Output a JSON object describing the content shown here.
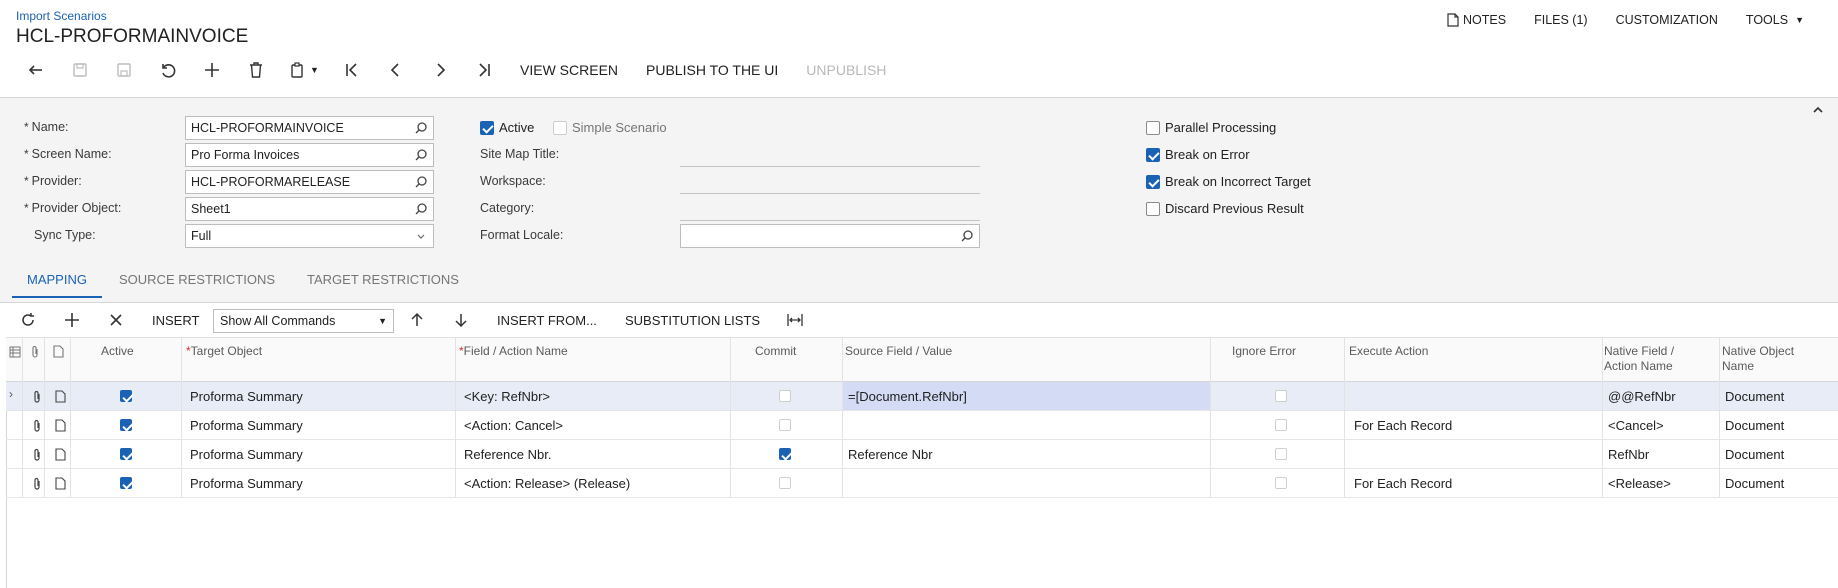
{
  "breadcrumb": "Import Scenarios",
  "page_title": "HCL-PROFORMAINVOICE",
  "top_links": {
    "notes": "NOTES",
    "files": "FILES (1)",
    "customization": "CUSTOMIZATION",
    "tools": "TOOLS"
  },
  "toolbar": {
    "view_screen": "VIEW SCREEN",
    "publish": "PUBLISH TO THE UI",
    "unpublish": "UNPUBLISH"
  },
  "form": {
    "name_label": "Name:",
    "name_value": "HCL-PROFORMAINVOICE",
    "screen_name_label": "Screen Name:",
    "screen_name_value": "Pro Forma Invoices",
    "provider_label": "Provider:",
    "provider_value": "HCL-PROFORMARELEASE",
    "provider_object_label": "Provider Object:",
    "provider_object_value": "Sheet1",
    "sync_type_label": "Sync Type:",
    "sync_type_value": "Full",
    "active_label": "Active",
    "simple_scenario_label": "Simple Scenario",
    "site_map_title_label": "Site Map Title:",
    "workspace_label": "Workspace:",
    "category_label": "Category:",
    "format_locale_label": "Format Locale:",
    "format_locale_value": "",
    "parallel_processing_label": "Parallel Processing",
    "break_on_error_label": "Break on Error",
    "break_on_incorrect_target_label": "Break on Incorrect Target",
    "discard_previous_result_label": "Discard Previous Result",
    "active_checked": true,
    "simple_scenario_checked": false,
    "parallel_processing_checked": false,
    "break_on_error_checked": true,
    "break_on_incorrect_target_checked": true,
    "discard_previous_result_checked": false
  },
  "tabs": [
    "MAPPING",
    "SOURCE RESTRICTIONS",
    "TARGET RESTRICTIONS"
  ],
  "grid_toolbar": {
    "insert": "INSERT",
    "commands_select": "Show All Commands",
    "insert_from": "INSERT FROM...",
    "substitution_lists": "SUBSTITUTION LISTS"
  },
  "columns": {
    "active": "Active",
    "target_object": "Target Object",
    "field_action_name": "Field / Action Name",
    "commit": "Commit",
    "source_field_value": "Source Field / Value",
    "ignore_error": "Ignore Error",
    "execute_action": "Execute Action",
    "native_field_line1": "Native Field /",
    "native_field_line2": "Action Name",
    "native_object_line1": "Native Object",
    "native_object_line2": "Name"
  },
  "rows": [
    {
      "active": true,
      "target_object": "Proforma Summary",
      "field_action_name": "<Key: RefNbr>",
      "commit": false,
      "source_field_value": "=[Document.RefNbr]",
      "ignore_error": false,
      "execute_action": "",
      "native_field": "@@RefNbr",
      "native_object": "Document"
    },
    {
      "active": true,
      "target_object": "Proforma Summary",
      "field_action_name": "<Action: Cancel>",
      "commit": false,
      "source_field_value": "",
      "ignore_error": false,
      "execute_action": "For Each Record",
      "native_field": "<Cancel>",
      "native_object": "Document"
    },
    {
      "active": true,
      "target_object": "Proforma Summary",
      "field_action_name": "Reference Nbr.",
      "commit": true,
      "source_field_value": "Reference Nbr",
      "ignore_error": false,
      "execute_action": "",
      "native_field": "RefNbr",
      "native_object": "Document"
    },
    {
      "active": true,
      "target_object": "Proforma Summary",
      "field_action_name": "<Action: Release> (Release)",
      "commit": false,
      "source_field_value": "",
      "ignore_error": false,
      "execute_action": "For Each Record",
      "native_field": "<Release>",
      "native_object": "Document"
    }
  ],
  "colors": {
    "accent": "#1a62b4",
    "selected_row": "#e8ecf7",
    "active_cell": "#d4dcf5",
    "form_bg": "#f4f4f4"
  }
}
